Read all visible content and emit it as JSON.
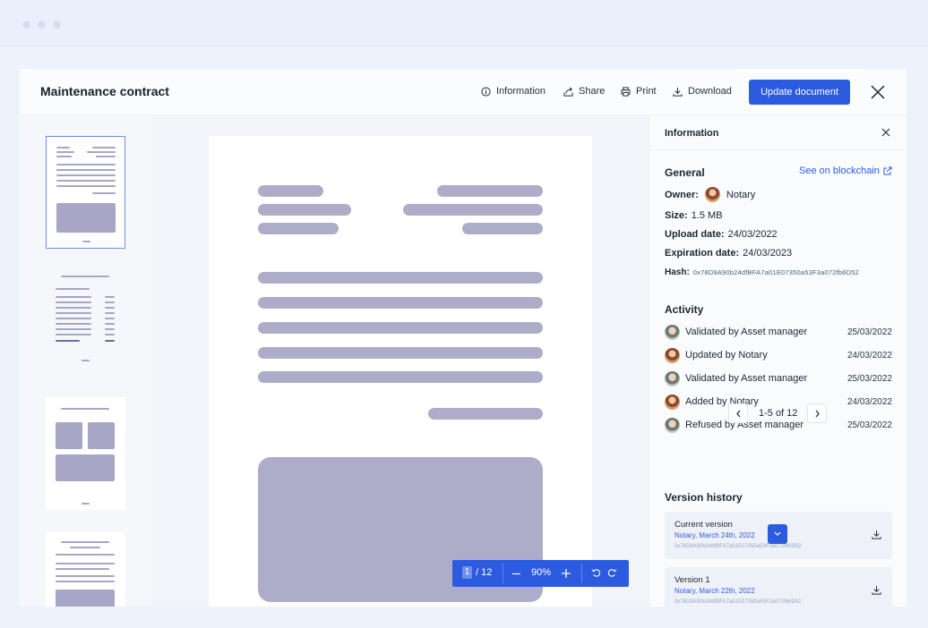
{
  "window": {
    "title": "Maintenance contract"
  },
  "toolbar": {
    "information_label": "Information",
    "share_label": "Share",
    "print_label": "Print",
    "download_label": "Download",
    "update_label": "Update document"
  },
  "viewer": {
    "current_page": "1",
    "total_pages": "/ 12",
    "zoom": "90%",
    "thumbnail_count": 4,
    "active_thumbnail": 1
  },
  "info_panel": {
    "title": "Information",
    "general": {
      "heading": "General",
      "blockchain_link": "See on blockchain",
      "owner_label": "Owner:",
      "owner_value": "Notary",
      "size_label": "Size:",
      "size_value": "1.5 MB",
      "upload_label": "Upload date:",
      "upload_value": "24/03/2022",
      "expiration_label": "Expiration date:",
      "expiration_value": "24/03/2023",
      "hash_label": "Hash:",
      "hash_value": "0x78D9A90b24dfBFA7a01E07350a53F3a072fb6D52"
    },
    "activity": {
      "heading": "Activity",
      "items": [
        {
          "text": "Validated by Asset manager",
          "date": "25/03/2022",
          "avatar": "asset-manager"
        },
        {
          "text": "Updated by Notary",
          "date": "24/03/2022",
          "avatar": "notary"
        },
        {
          "text": "Validated by Asset manager",
          "date": "25/03/2022",
          "avatar": "asset-manager"
        },
        {
          "text": "Added by Notary",
          "date": "24/03/2022",
          "avatar": "notary"
        },
        {
          "text": "Refused by Asset manager",
          "date": "25/03/2022",
          "avatar": "asset-manager"
        }
      ],
      "pagination": "1-5 of 12"
    },
    "versions": {
      "heading": "Version history",
      "items": [
        {
          "title": "Current version",
          "meta": "Notary, March 24th, 2022",
          "hash": "0x78D9A90b24dfBFA7a01E07350a53F3a072fb6D52"
        },
        {
          "title": "Version 1",
          "meta": "Notary, March 22th, 2022",
          "hash": "0x78D9A90b24dfBFA7a01E07350a53F3a072fb6D52"
        }
      ]
    }
  },
  "colors": {
    "accent": "#2d5be0",
    "placeholder": "#aeadc9"
  },
  "icons": [
    "info-icon",
    "share-icon",
    "print-icon",
    "download-icon",
    "close-icon",
    "external-link-icon",
    "chevron-left-icon",
    "chevron-right-icon",
    "minus-icon",
    "plus-icon",
    "rotate-left-icon",
    "rotate-right-icon",
    "chevron-down-icon"
  ]
}
